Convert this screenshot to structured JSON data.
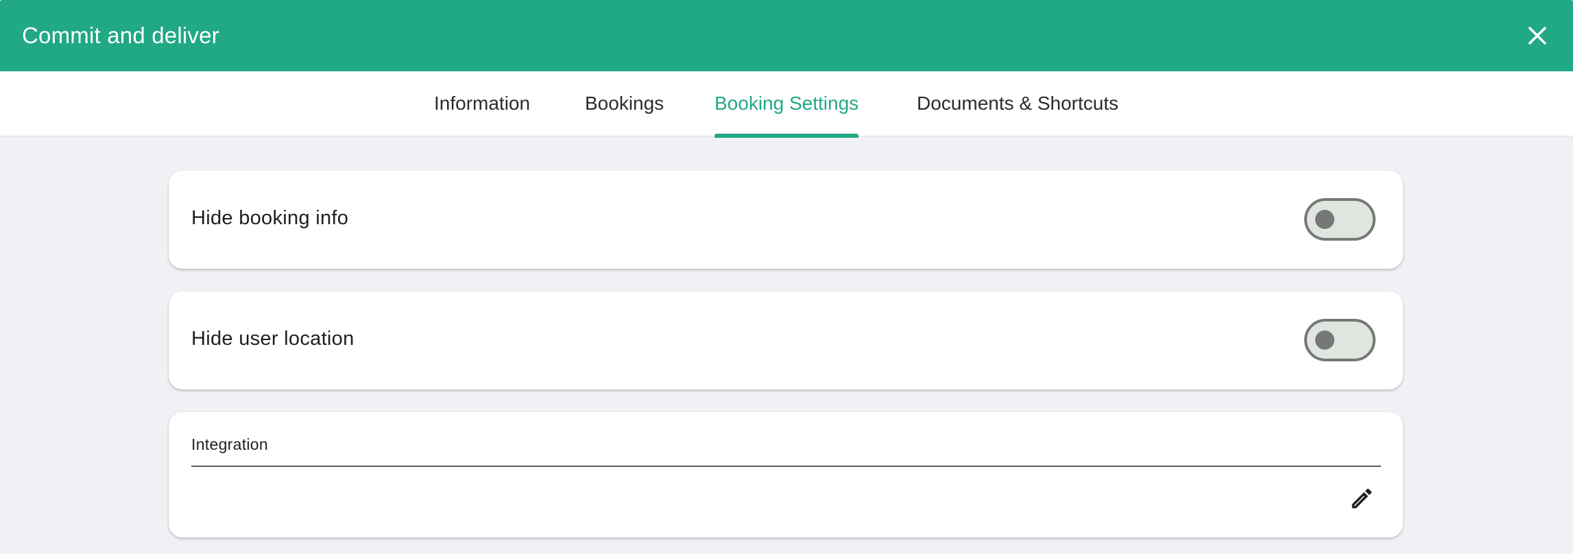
{
  "dialog": {
    "title": "Commit and deliver",
    "close_icon": "close-icon"
  },
  "tabs": [
    {
      "label": "Information",
      "active": false
    },
    {
      "label": "Bookings",
      "active": false
    },
    {
      "label": "Booking Settings",
      "active": true
    },
    {
      "label": "Documents & Shortcuts",
      "active": false
    }
  ],
  "settings": {
    "hide_booking_info": {
      "label": "Hide booking info",
      "enabled": false
    },
    "hide_user_location": {
      "label": "Hide user location",
      "enabled": false
    },
    "integration": {
      "label": "Integration",
      "value": "",
      "edit_icon": "pencil-icon"
    }
  },
  "colors": {
    "accent": "#21a884",
    "background": "#f0f1f5",
    "card": "#ffffff",
    "switch_off_track": "#dfe6df",
    "switch_off_border": "#777777"
  }
}
